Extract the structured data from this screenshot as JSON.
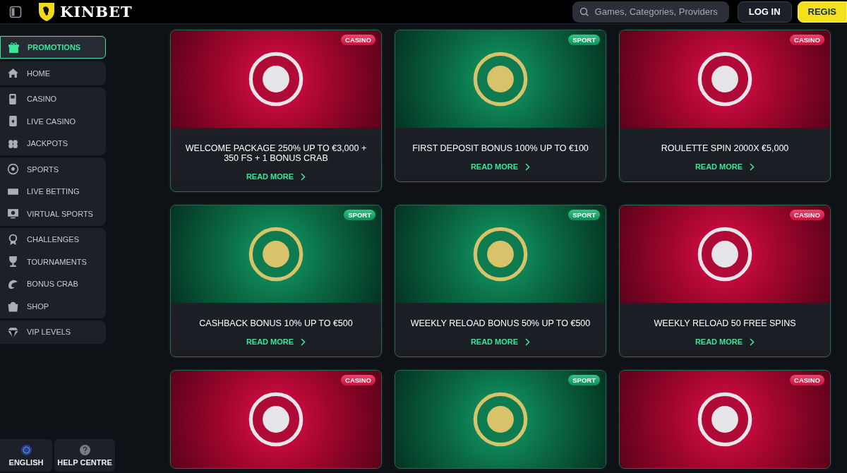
{
  "header": {
    "logo_text": "KINBET",
    "search": {
      "placeholder": "Games, Categories, Providers"
    },
    "login_button": "LOG IN",
    "register_button": "REGIS"
  },
  "sidebar": {
    "groups": [
      {
        "items": [
          {
            "label": "PROMOTIONS",
            "selected": true
          }
        ]
      },
      {
        "items": [
          {
            "label": "HOME",
            "selected": false
          }
        ]
      },
      {
        "items": [
          {
            "label": "CASINO",
            "selected": false
          },
          {
            "label": "LIVE CASINO",
            "selected": false
          },
          {
            "label": "JACKPOTS",
            "selected": false
          }
        ]
      },
      {
        "items": [
          {
            "label": "SPORTS",
            "selected": false
          },
          {
            "label": "LIVE BETTING",
            "selected": false
          },
          {
            "label": "VIRTUAL SPORTS",
            "selected": false
          }
        ]
      },
      {
        "items": [
          {
            "label": "CHALLENGES",
            "selected": false
          },
          {
            "label": "TOURNAMENTS",
            "selected": false
          },
          {
            "label": "BONUS CRAB",
            "selected": false
          },
          {
            "label": "SHOP",
            "selected": false
          }
        ]
      },
      {
        "items": [
          {
            "label": "VIP LEVELS",
            "selected": false
          }
        ]
      }
    ],
    "footer": [
      {
        "label": "ENGLISH"
      },
      {
        "label": "HELP CENTRE"
      }
    ]
  },
  "promotions": [
    {
      "kind": "casino",
      "tag": "CASINO",
      "title": "WELCOME PACKAGE 250% UP TO €3,000 + 350 FS + 1 BONUS CRAB",
      "link": "READ MORE"
    },
    {
      "kind": "sport",
      "tag": "SPORT",
      "title": "FIRST DEPOSIT BONUS 100% UP TO €100",
      "link": "READ MORE"
    },
    {
      "kind": "casino",
      "tag": "CASINO",
      "title": "ROULETTE SPIN 2000X €5,000",
      "link": "READ MORE"
    },
    {
      "kind": "sport",
      "tag": "SPORT",
      "title": "CASHBACK BONUS 10% UP TO €500",
      "link": "READ MORE"
    },
    {
      "kind": "sport",
      "tag": "SPORT",
      "title": "WEEKLY RELOAD BONUS 50% UP TO €500",
      "link": "READ MORE"
    },
    {
      "kind": "casino",
      "tag": "CASINO",
      "title": "WEEKLY RELOAD 50 FREE SPINS",
      "link": "READ MORE"
    },
    {
      "kind": "casino",
      "tag": "CASINO"
    },
    {
      "kind": "sport",
      "tag": "SPORT"
    },
    {
      "kind": "casino",
      "tag": "CASINO"
    }
  ]
}
